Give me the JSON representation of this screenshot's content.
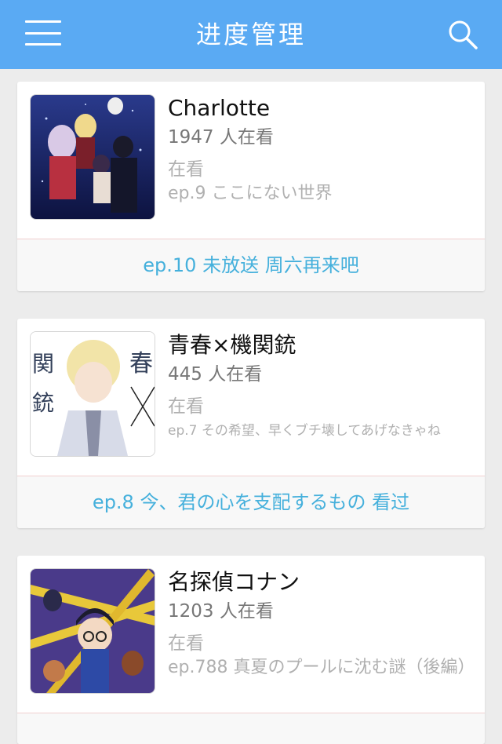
{
  "colors": {
    "nav_bg": "#5aaaf3",
    "accent": "#45b0dc",
    "divider": "#f1cfcf"
  },
  "navbar": {
    "title": "进度管理",
    "menu_icon": "hamburger-menu-icon",
    "search_icon": "search-icon"
  },
  "shows": [
    {
      "title": "Charlotte",
      "watchers": "1947 人在看",
      "status": "在看",
      "episode": "ep.9 ここにない世界",
      "next_action": "ep.10 未放送 周六再来吧"
    },
    {
      "title": "青春×機関銃",
      "watchers": "445 人在看",
      "status": "在看",
      "episode": "ep.7 その希望、早くブチ壊してあげなきゃね",
      "next_action": "ep.8 今、君の心を支配するもの 看过",
      "cover_text": [
        "春",
        "関",
        "銃"
      ]
    },
    {
      "title": "名探偵コナン",
      "watchers": "1203 人在看",
      "status": "在看",
      "episode": "ep.788 真夏のプールに沈む謎（後編）",
      "next_action": ""
    }
  ]
}
